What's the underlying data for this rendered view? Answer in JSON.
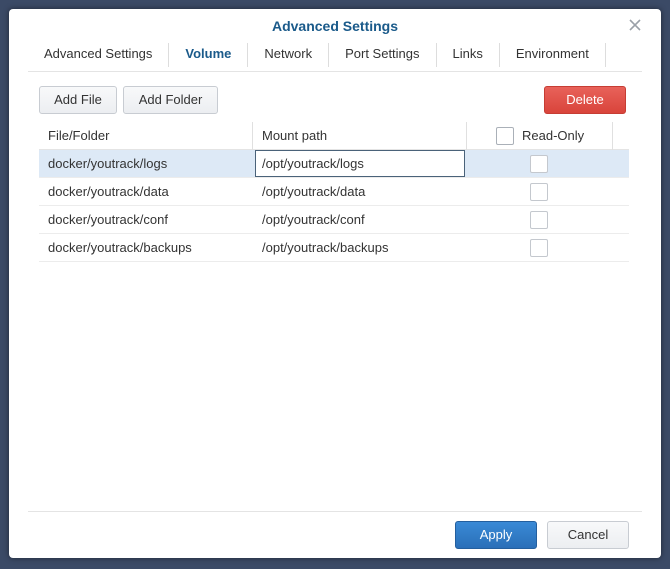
{
  "window": {
    "title": "Advanced Settings"
  },
  "tabs": [
    {
      "label": "Advanced Settings",
      "active": false
    },
    {
      "label": "Volume",
      "active": true
    },
    {
      "label": "Network",
      "active": false
    },
    {
      "label": "Port Settings",
      "active": false
    },
    {
      "label": "Links",
      "active": false
    },
    {
      "label": "Environment",
      "active": false
    }
  ],
  "toolbar": {
    "add_file_label": "Add File",
    "add_folder_label": "Add Folder",
    "delete_label": "Delete"
  },
  "table": {
    "headers": {
      "file_folder": "File/Folder",
      "mount_path": "Mount path",
      "read_only": "Read-Only"
    },
    "rows": [
      {
        "file_folder": "docker/youtrack/logs",
        "mount_path": "/opt/youtrack/logs",
        "read_only": false,
        "selected": true
      },
      {
        "file_folder": "docker/youtrack/data",
        "mount_path": "/opt/youtrack/data",
        "read_only": false,
        "selected": false
      },
      {
        "file_folder": "docker/youtrack/conf",
        "mount_path": "/opt/youtrack/conf",
        "read_only": false,
        "selected": false
      },
      {
        "file_folder": "docker/youtrack/backups",
        "mount_path": "/opt/youtrack/backups",
        "read_only": false,
        "selected": false
      }
    ]
  },
  "footer": {
    "apply_label": "Apply",
    "cancel_label": "Cancel"
  },
  "colors": {
    "accent": "#1a5a8a",
    "delete": "#d9443b",
    "apply": "#2a6fb8",
    "selected_row": "#dde9f6"
  },
  "icons": {
    "close": "close-icon"
  }
}
